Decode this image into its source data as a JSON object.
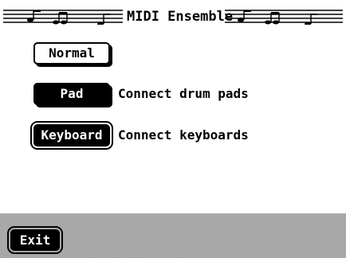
{
  "screen": {
    "title": "MIDI Ensemble"
  },
  "options": {
    "normal_label": "Normal",
    "pad_label": "Pad",
    "pad_description": "Connect drum pads",
    "keyboard_label": "Keyboard",
    "keyboard_description": "Connect keyboards",
    "selected": "Keyboard"
  },
  "footer": {
    "exit_label": "Exit"
  },
  "icons": {
    "title_decoration": "music-staff-icon"
  },
  "colors": {
    "background": "#ffffff",
    "foreground": "#000000",
    "footer_pattern": "#7c7c7c"
  }
}
